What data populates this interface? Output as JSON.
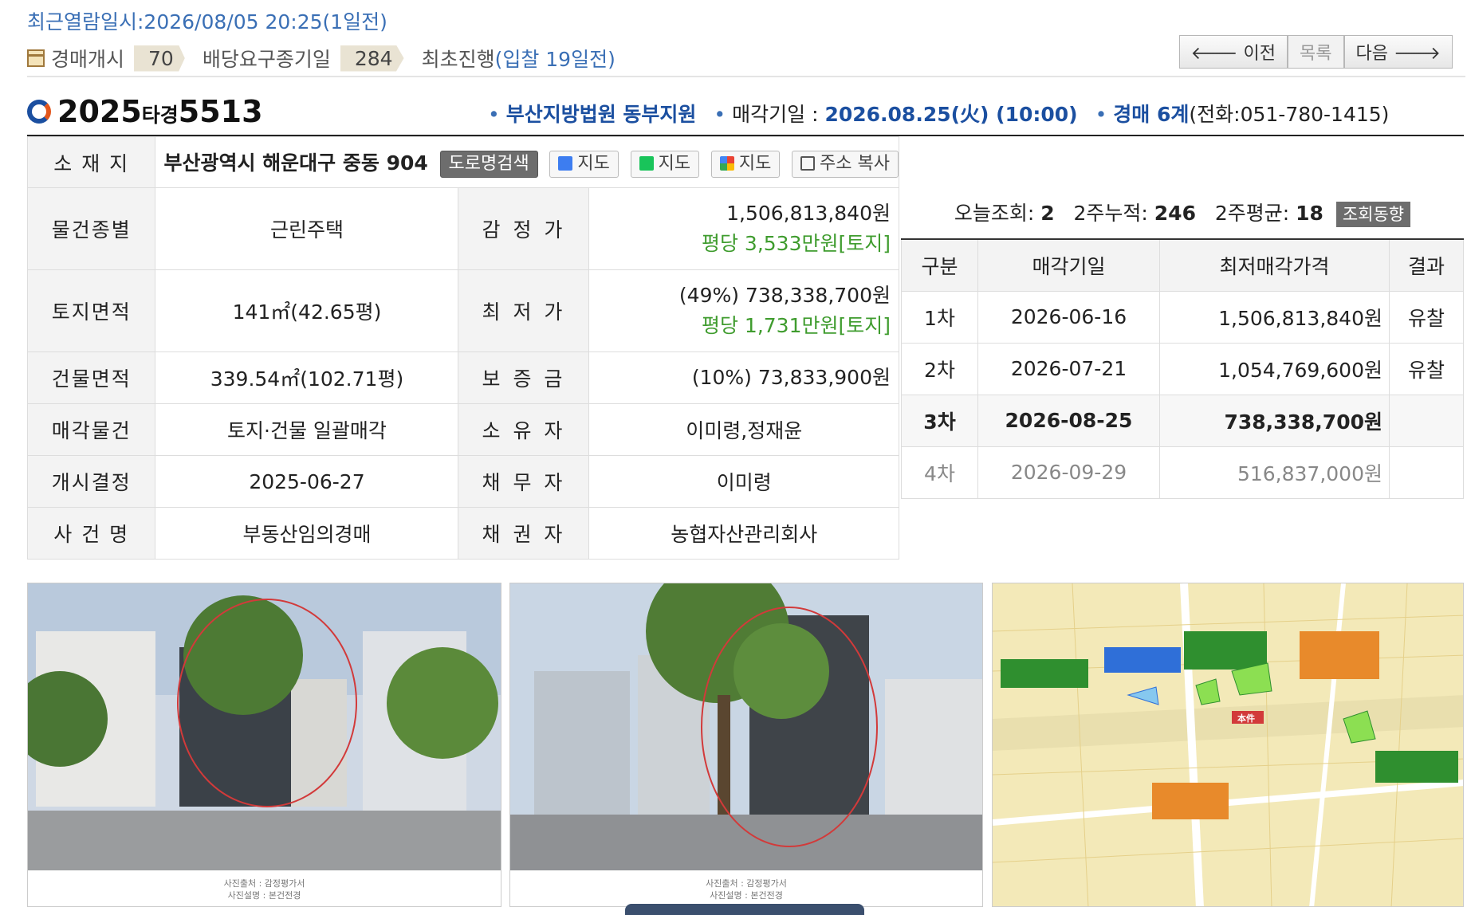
{
  "header": {
    "recent_view": "최근열람일시:2026/08/05 20:25(1일전)",
    "start_label": "경매개시",
    "start_days": "70",
    "claim_label": "배당요구종기일",
    "claim_days": "284",
    "first_label": "최초진행",
    "first_value": "(입찰 19일전)"
  },
  "nav": {
    "prev": "🡐 이전",
    "list": "목록",
    "next": "다음 🡒"
  },
  "case": {
    "number_prefix": "2025",
    "number_type": "타경",
    "number_suffix": "5513",
    "court": "부산지방법원 동부지원",
    "sale_label": "매각기일 : ",
    "sale_date": "2026.08.25(火) (10:00)",
    "dept": "경매 6계",
    "phone": "(전화:051-780-1415)"
  },
  "address": {
    "label": "소 재 지",
    "value": "부산광역시 해운대구 중동 904",
    "road_search": "도로명검색",
    "map_daum": "지도",
    "map_naver": "지도",
    "map_google": "지도",
    "copy": "주소 복사"
  },
  "details": {
    "type_label": "물건종별",
    "type_value": "근린주택",
    "appraisal_label": "감 정 가",
    "appraisal_value": "1,506,813,840원",
    "appraisal_per": "평당 3,533만원[토지]",
    "land_label": "토지면적",
    "land_value": "141㎡(42.65평)",
    "min_label": "최 저 가",
    "min_value": "(49%) 738,338,700원",
    "min_per": "평당 1,731만원[토지]",
    "bldg_label": "건물면적",
    "bldg_value": "339.54㎡(102.71평)",
    "deposit_label": "보 증 금",
    "deposit_value": "(10%) 73,833,900원",
    "sale_obj_label": "매각물건",
    "sale_obj_value": "토지·건물 일괄매각",
    "owner_label": "소 유 자",
    "owner_value": "이미령,정재윤",
    "start_label": "개시결정",
    "start_value": "2025-06-27",
    "debtor_label": "채 무 자",
    "debtor_value": "이미령",
    "case_name_label": "사 건 명",
    "case_name_value": "부동산임의경매",
    "creditor_label": "채 권 자",
    "creditor_value": "농협자산관리회사"
  },
  "views": {
    "today_label": "오늘조회: ",
    "today": "2",
    "two_week_label": "2주누적: ",
    "two_week": "246",
    "avg_label": "2주평균: ",
    "avg": "18",
    "trend_button": "조회동향"
  },
  "rounds": {
    "headers": [
      "구분",
      "매각기일",
      "최저매각가격",
      "결과"
    ],
    "rows": [
      {
        "round": "1차",
        "date": "2026-06-16",
        "price": "1,506,813,840원",
        "result": "유찰"
      },
      {
        "round": "2차",
        "date": "2026-07-21",
        "price": "1,054,769,600원",
        "result": "유찰"
      },
      {
        "round": "3차",
        "date": "2026-08-25",
        "price": "738,338,700원",
        "result": ""
      },
      {
        "round": "4차",
        "date": "2026-09-29",
        "price": "516,837,000원",
        "result": ""
      }
    ]
  },
  "photos": {
    "caption1a": "사진출처 : 감정평가서",
    "caption1b": "사진설명 : 본건전경",
    "caption2a": "사진출처 : 감정평가서",
    "caption2b": "사진설명 : 본건전경",
    "map_marker": "本件"
  }
}
